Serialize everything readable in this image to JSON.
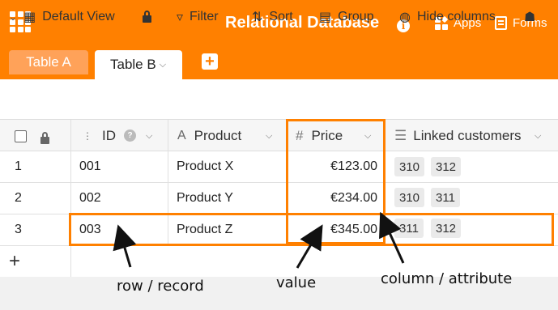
{
  "header": {
    "title": "Relational Database",
    "apps_label": "Apps",
    "forms_label": "Forms",
    "info_glyph": "i",
    "accent_color": "#ff8000"
  },
  "tabs": [
    {
      "label": "Table A",
      "active": false
    },
    {
      "label": "Table B",
      "active": true
    }
  ],
  "toolbar": {
    "view_label": "Default View",
    "filter_label": "Filter",
    "sort_label": "Sort",
    "group_label": "Group",
    "hide_columns_label": "Hide columns"
  },
  "table": {
    "columns": [
      {
        "label": "ID",
        "icon": "autonumber-icon"
      },
      {
        "label": "Product",
        "icon": "text-icon"
      },
      {
        "label": "Price",
        "icon": "hash-icon"
      },
      {
        "label": "Linked customers",
        "icon": "link-icon"
      }
    ],
    "rows": [
      {
        "index": "1",
        "id": "001",
        "product": "Product X",
        "price": "€123.00",
        "links": [
          "310",
          "312"
        ]
      },
      {
        "index": "2",
        "id": "002",
        "product": "Product Y",
        "price": "€234.00",
        "links": [
          "310",
          "311"
        ]
      },
      {
        "index": "3",
        "id": "003",
        "product": "Product Z",
        "price": "€345.00",
        "links": [
          "311",
          "312"
        ]
      }
    ],
    "add_row_glyph": "+"
  },
  "annotations": {
    "row_label": "row / record",
    "value_label": "value",
    "column_label": "column / attribute"
  }
}
